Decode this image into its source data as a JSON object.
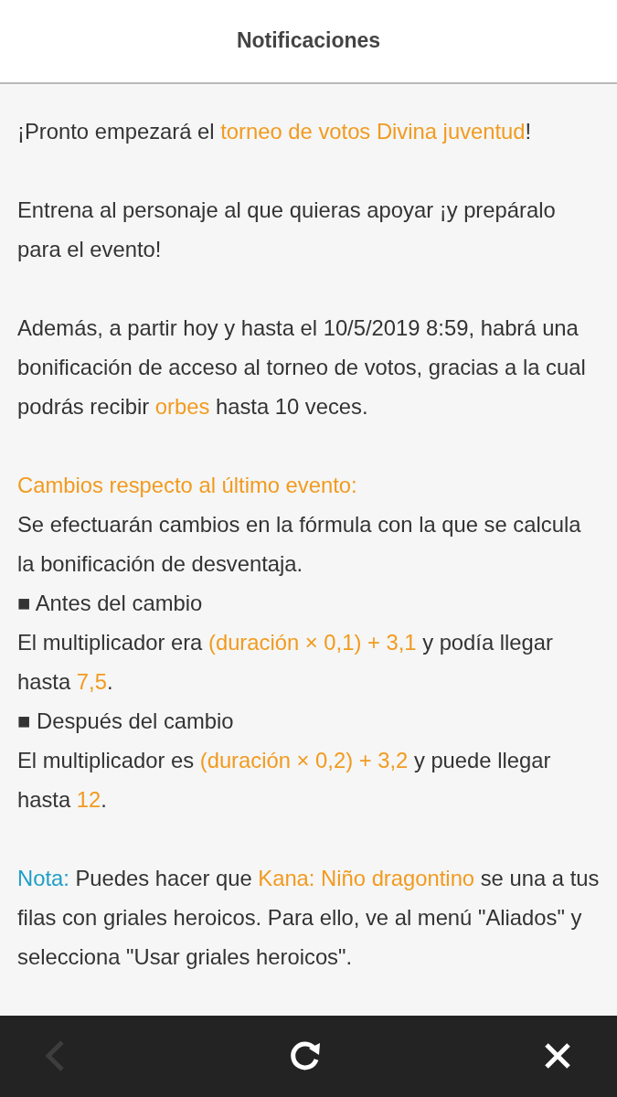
{
  "header": {
    "title": "Notificaciones"
  },
  "blocks": [
    {
      "lines": [
        [
          {
            "kind": "text",
            "text": "¡Pronto empezará el "
          },
          {
            "kind": "link",
            "text": "torneo de votos Divina juventud"
          },
          {
            "kind": "text",
            "text": "!"
          }
        ]
      ]
    },
    {
      "lines": [
        [
          {
            "kind": "text",
            "text": "Entrena al personaje al que quieras apoyar ¡y prepáralo para el evento!"
          }
        ]
      ]
    },
    {
      "lines": [
        [
          {
            "kind": "text",
            "text": "Además, a partir hoy y hasta el 10/5/2019 8:59, habrá una bonificación de acceso al torneo de votos, gracias a la cual podrás recibir "
          },
          {
            "kind": "highlight",
            "text": "orbes"
          },
          {
            "kind": "text",
            "text": " hasta 10 veces."
          }
        ]
      ]
    },
    {
      "lines": [
        [
          {
            "kind": "highlight",
            "text": "Cambios respecto al último evento:"
          }
        ],
        [
          {
            "kind": "text",
            "text": "Se efectuarán cambios en la fórmula con la que se calcula la bonificación de desventaja."
          }
        ],
        [
          {
            "kind": "text",
            "text": "■ Antes del cambio"
          }
        ],
        [
          {
            "kind": "text",
            "text": "El multiplicador era "
          },
          {
            "kind": "highlight",
            "text": "(duración × 0,1) + 3,1"
          },
          {
            "kind": "text",
            "text": " y podía llegar hasta "
          },
          {
            "kind": "highlight",
            "text": "7,5"
          },
          {
            "kind": "text",
            "text": "."
          }
        ],
        [
          {
            "kind": "text",
            "text": "■ Después del cambio"
          }
        ],
        [
          {
            "kind": "text",
            "text": "El multiplicador es "
          },
          {
            "kind": "highlight",
            "text": "(duración × 0,2) + 3,2"
          },
          {
            "kind": "text",
            "text": " y puede llegar hasta "
          },
          {
            "kind": "highlight",
            "text": "12"
          },
          {
            "kind": "text",
            "text": "."
          }
        ]
      ]
    },
    {
      "lines": [
        [
          {
            "kind": "note",
            "text": "Nota:"
          },
          {
            "kind": "text",
            "text": " Puedes hacer que "
          },
          {
            "kind": "highlight",
            "text": "Kana: Niño dragontino"
          },
          {
            "kind": "text",
            "text": " se una a tus filas con griales heroicos. Para ello, ve al menú \"Aliados\" y selecciona \"Usar griales heroicos\"."
          }
        ]
      ]
    }
  ],
  "toolbar": [
    {
      "kind": "back",
      "disabled": true
    },
    {
      "kind": "refresh",
      "disabled": false
    },
    {
      "kind": "close",
      "disabled": false
    }
  ]
}
